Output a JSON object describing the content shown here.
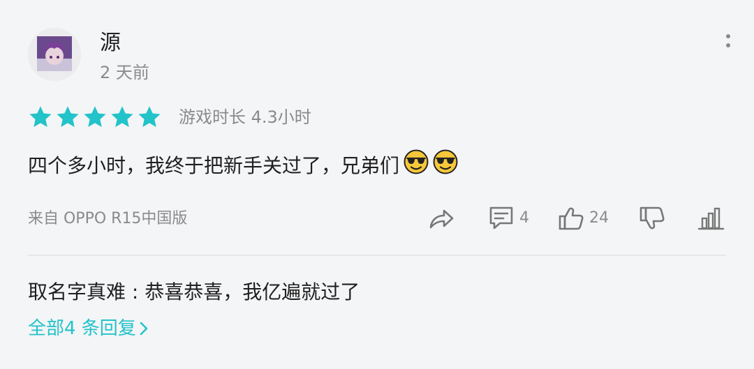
{
  "user": {
    "name": "源",
    "time": "2 天前"
  },
  "rating": {
    "stars": 5,
    "max": 5,
    "playtime": "游戏时长 4.3小时"
  },
  "review": {
    "text": "四个多小时，我终于把新手关过了，兄弟们",
    "emojis": [
      "sunglasses-emoji",
      "sunglasses-emoji"
    ]
  },
  "device": "来自 OPPO R15中国版",
  "actions": {
    "comments": "4",
    "likes": "24"
  },
  "reply": {
    "author": "取名字真难",
    "separator": " : ",
    "text": "恭喜恭喜，我亿遍就过了"
  },
  "all_replies": {
    "label": "全部4 条回复"
  },
  "colors": {
    "accent": "#22c3c9",
    "muted": "#8a8a8a",
    "background": "#f4f5f7"
  }
}
